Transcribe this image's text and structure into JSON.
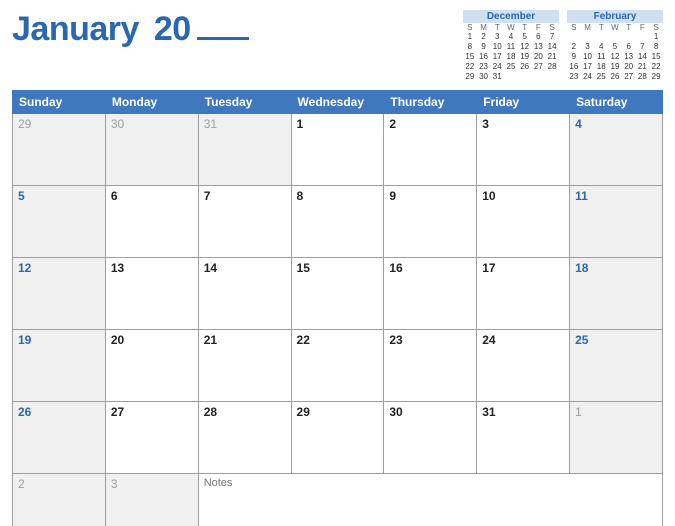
{
  "title": {
    "month": "January",
    "yearPrefix": "20"
  },
  "dayHeaders": [
    "Sunday",
    "Monday",
    "Tuesday",
    "Wednesday",
    "Thursday",
    "Friday",
    "Saturday"
  ],
  "weeks": [
    [
      {
        "n": "29",
        "t": "other"
      },
      {
        "n": "30",
        "t": "other"
      },
      {
        "n": "31",
        "t": "other"
      },
      {
        "n": "1",
        "t": "day"
      },
      {
        "n": "2",
        "t": "day"
      },
      {
        "n": "3",
        "t": "day"
      },
      {
        "n": "4",
        "t": "weekend"
      }
    ],
    [
      {
        "n": "5",
        "t": "weekend"
      },
      {
        "n": "6",
        "t": "day"
      },
      {
        "n": "7",
        "t": "day"
      },
      {
        "n": "8",
        "t": "day"
      },
      {
        "n": "9",
        "t": "day"
      },
      {
        "n": "10",
        "t": "day"
      },
      {
        "n": "11",
        "t": "weekend"
      }
    ],
    [
      {
        "n": "12",
        "t": "weekend"
      },
      {
        "n": "13",
        "t": "day"
      },
      {
        "n": "14",
        "t": "day"
      },
      {
        "n": "15",
        "t": "day"
      },
      {
        "n": "16",
        "t": "day"
      },
      {
        "n": "17",
        "t": "day"
      },
      {
        "n": "18",
        "t": "weekend"
      }
    ],
    [
      {
        "n": "19",
        "t": "weekend"
      },
      {
        "n": "20",
        "t": "day"
      },
      {
        "n": "21",
        "t": "day"
      },
      {
        "n": "22",
        "t": "day"
      },
      {
        "n": "23",
        "t": "day"
      },
      {
        "n": "24",
        "t": "day"
      },
      {
        "n": "25",
        "t": "weekend"
      }
    ],
    [
      {
        "n": "26",
        "t": "weekend"
      },
      {
        "n": "27",
        "t": "day"
      },
      {
        "n": "28",
        "t": "day"
      },
      {
        "n": "29",
        "t": "day"
      },
      {
        "n": "30",
        "t": "day"
      },
      {
        "n": "31",
        "t": "day"
      },
      {
        "n": "1",
        "t": "other"
      }
    ]
  ],
  "notesRow": {
    "left": [
      {
        "n": "2",
        "t": "other"
      },
      {
        "n": "3",
        "t": "other"
      }
    ],
    "notesLabel": "Notes"
  },
  "miniDayHeaders": [
    "S",
    "M",
    "T",
    "W",
    "T",
    "F",
    "S"
  ],
  "miniCalendars": [
    {
      "title": "December",
      "rows": [
        [
          "1",
          "2",
          "3",
          "4",
          "5",
          "6",
          "7"
        ],
        [
          "8",
          "9",
          "10",
          "11",
          "12",
          "13",
          "14"
        ],
        [
          "15",
          "16",
          "17",
          "18",
          "19",
          "20",
          "21"
        ],
        [
          "22",
          "23",
          "24",
          "25",
          "26",
          "27",
          "28"
        ],
        [
          "29",
          "30",
          "31",
          "",
          "",
          "",
          ""
        ]
      ]
    },
    {
      "title": "February",
      "rows": [
        [
          "",
          "",
          "",
          "",
          "",
          "",
          "1"
        ],
        [
          "2",
          "3",
          "4",
          "5",
          "6",
          "7",
          "8"
        ],
        [
          "9",
          "10",
          "11",
          "12",
          "13",
          "14",
          "15"
        ],
        [
          "16",
          "17",
          "18",
          "19",
          "20",
          "21",
          "22"
        ],
        [
          "23",
          "24",
          "25",
          "26",
          "27",
          "28",
          "29"
        ]
      ]
    }
  ]
}
